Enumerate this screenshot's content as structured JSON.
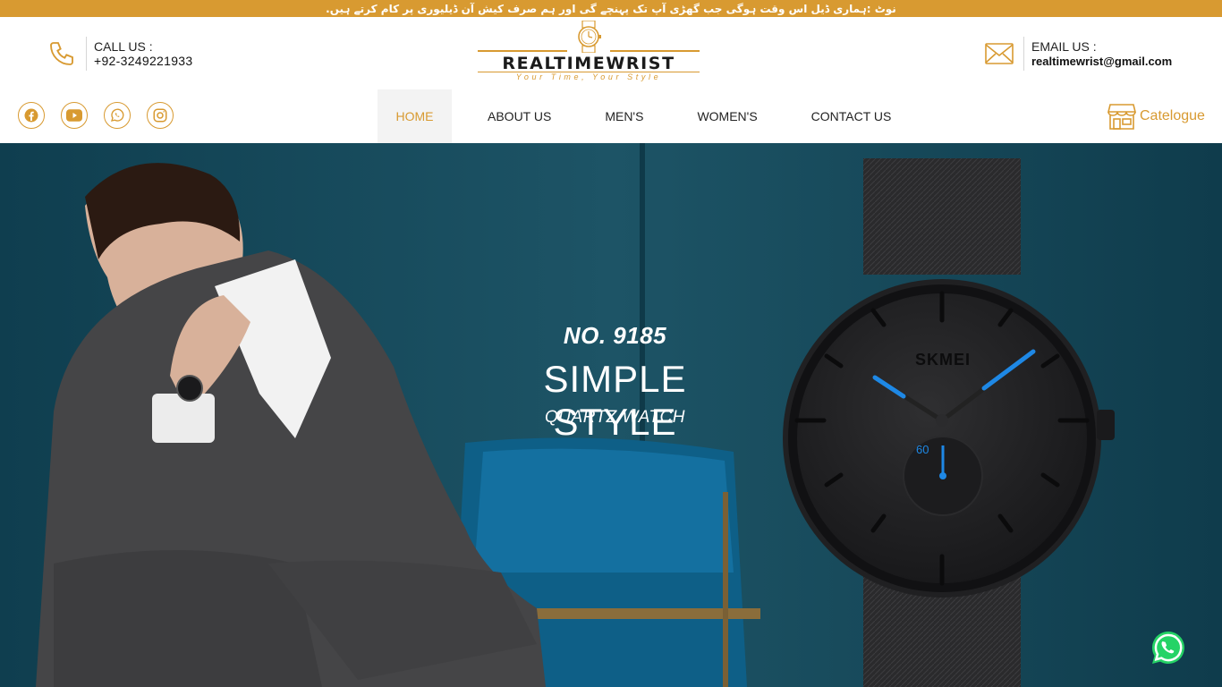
{
  "notice": {
    "text": "نوٹ :ہماری ڈیل اس وقت ہوگی جب گھڑی آپ تک پہنچے گی اور ہم صرف کیش آن ڈیلیوری پر کام کرتے ہیں."
  },
  "header": {
    "call": {
      "label": "CALL US :",
      "value": "+92-3249221933",
      "icon": "phone-icon"
    },
    "email": {
      "label": "EMAIL US :",
      "value": "realtimewrist@gmail.com",
      "icon": "envelope-icon"
    },
    "logo": {
      "brand": "REALTIMEWRIST",
      "tagline": "Your Time, Your Style"
    }
  },
  "social": [
    {
      "name": "facebook",
      "icon": "facebook-icon"
    },
    {
      "name": "youtube",
      "icon": "youtube-icon"
    },
    {
      "name": "whatsapp",
      "icon": "whatsapp-icon"
    },
    {
      "name": "instagram",
      "icon": "instagram-icon"
    }
  ],
  "nav": {
    "items": [
      {
        "label": "HOME",
        "active": true
      },
      {
        "label": "ABOUT US",
        "active": false
      },
      {
        "label": "MEN'S",
        "active": false
      },
      {
        "label": "WOMEN'S",
        "active": false
      },
      {
        "label": "CONTACT US",
        "active": false
      }
    ]
  },
  "catalogue": {
    "label": "Catelogue",
    "icon": "store-icon"
  },
  "hero": {
    "model": "NO. 9185",
    "headline": "SIMPLE STYLE",
    "subline": "QUARTZ WATCH",
    "watch_brand": "SKMEI",
    "subdial_label": "60"
  },
  "colors": {
    "accent": "#d89a31",
    "hero_bg": "#1b4e5f",
    "whatsapp": "#25d366",
    "watch_hands": "#1e88e5"
  }
}
